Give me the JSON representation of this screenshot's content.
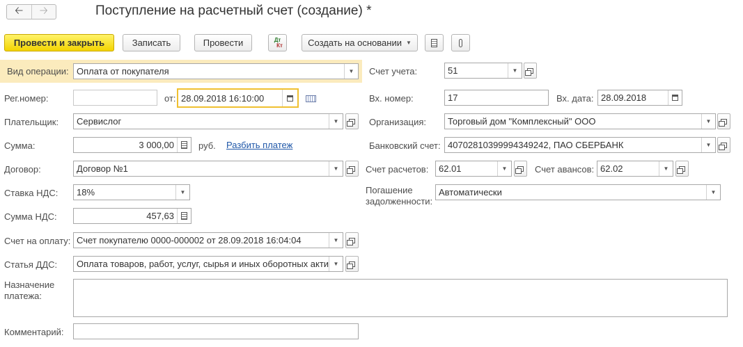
{
  "window": {
    "title": "Поступление на расчетный счет (создание) *"
  },
  "toolbar": {
    "post_close": "Провести и закрыть",
    "save": "Записать",
    "post": "Провести",
    "dtkt_top": "Дт",
    "dtkt_bottom": "Кт",
    "create_based": "Создать на основании"
  },
  "form": {
    "operation_type": {
      "label": "Вид операции:",
      "value": "Оплата от покупателя"
    },
    "reg_number": {
      "label": "Рег.номер:",
      "value": ""
    },
    "date": {
      "label": "от:",
      "value": "28.09.2018 16:10:00"
    },
    "payer": {
      "label": "Плательщик:",
      "value": "Сервислог"
    },
    "amount": {
      "label": "Сумма:",
      "value": "3 000,00",
      "currency": "руб.",
      "split_link": "Разбить платеж"
    },
    "contract": {
      "label": "Договор:",
      "value": "Договор №1"
    },
    "vat_rate": {
      "label": "Ставка НДС:",
      "value": "18%"
    },
    "vat_amount": {
      "label": "Сумма НДС:",
      "value": "457,63"
    },
    "invoice": {
      "label": "Счет на оплату:",
      "value": "Счет покупателю 0000-000002 от 28.09.2018 16:04:04"
    },
    "cashflow_item": {
      "label": "Статья ДДС:",
      "value": "Оплата товаров, работ, услуг, сырья и иных оборотных акти"
    },
    "purpose": {
      "label_line1": "Назначение",
      "label_line2": "платежа:",
      "value": ""
    },
    "comment": {
      "label": "Комментарий:",
      "value": ""
    },
    "account": {
      "label": "Счет учета:",
      "value": "51"
    },
    "in_number": {
      "label": "Вх. номер:",
      "value": "17"
    },
    "in_date": {
      "label": "Вх. дата:",
      "value": "28.09.2018"
    },
    "organization": {
      "label": "Организация:",
      "value": "Торговый дом \"Комплексный\" ООО"
    },
    "bank_account": {
      "label": "Банковский счет:",
      "value": "40702810399994349242, ПАО СБЕРБАНК"
    },
    "settlement_account": {
      "label": "Счет расчетов:",
      "value": "62.01"
    },
    "advance_account": {
      "label": "Счет авансов:",
      "value": "62.02"
    },
    "repayment": {
      "label_line1": "Погашение",
      "label_line2": "задолженности:",
      "value": "Автоматически"
    }
  },
  "colors": {
    "primary_button": "#f3d400",
    "highlight_row": "#fbebbd",
    "focus_border": "#f0c030",
    "link": "#1f57a8"
  }
}
